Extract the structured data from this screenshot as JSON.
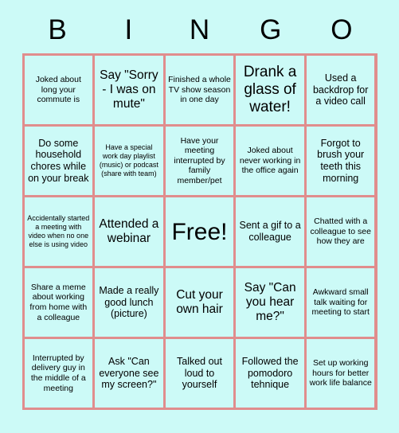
{
  "card": {
    "title_letters": [
      "B",
      "I",
      "N",
      "G",
      "O"
    ],
    "background_color": "#ccfaf7",
    "border_color": "#e08d8d",
    "text_color": "#000000",
    "rows": [
      [
        {
          "text": "Joked about long your commute is",
          "size": "s"
        },
        {
          "text": "Say \"Sorry - I was on mute\"",
          "size": "l"
        },
        {
          "text": "Finished a whole TV show season in one day",
          "size": "s"
        },
        {
          "text": "Drank a glass of water!",
          "size": "xl"
        },
        {
          "text": "Used a backdrop for a video call",
          "size": "m"
        }
      ],
      [
        {
          "text": "Do some household chores while on your break",
          "size": "m"
        },
        {
          "text": "Have a special work day playlist (music) or podcast (share with team)",
          "size": "xs"
        },
        {
          "text": "Have your meeting interrupted by family member/pet",
          "size": "s"
        },
        {
          "text": "Joked about never working in the office again",
          "size": "s"
        },
        {
          "text": "Forgot to brush your teeth this morning",
          "size": "m"
        }
      ],
      [
        {
          "text": "Accidentally started a meeting with video when no one else is using video",
          "size": "xs"
        },
        {
          "text": "Attended a webinar",
          "size": "l"
        },
        {
          "text": "Free!",
          "size": "xxl"
        },
        {
          "text": "Sent a gif to a colleague",
          "size": "m"
        },
        {
          "text": "Chatted with a colleague to see how they are",
          "size": "s"
        }
      ],
      [
        {
          "text": "Share a meme about working from home with a colleague",
          "size": "s"
        },
        {
          "text": "Made a really good lunch (picture)",
          "size": "m"
        },
        {
          "text": "Cut your own hair",
          "size": "l"
        },
        {
          "text": "Say \"Can you hear me?\"",
          "size": "l"
        },
        {
          "text": "Awkward small talk waiting for meeting to start",
          "size": "s"
        }
      ],
      [
        {
          "text": "Interrupted by delivery guy in the middle of a meeting",
          "size": "s"
        },
        {
          "text": "Ask \"Can everyone see my screen?\"",
          "size": "m"
        },
        {
          "text": "Talked out loud to yourself",
          "size": "m"
        },
        {
          "text": "Followed the pomodoro tehnique",
          "size": "m"
        },
        {
          "text": "Set up working hours for better work life balance",
          "size": "s"
        }
      ]
    ]
  }
}
